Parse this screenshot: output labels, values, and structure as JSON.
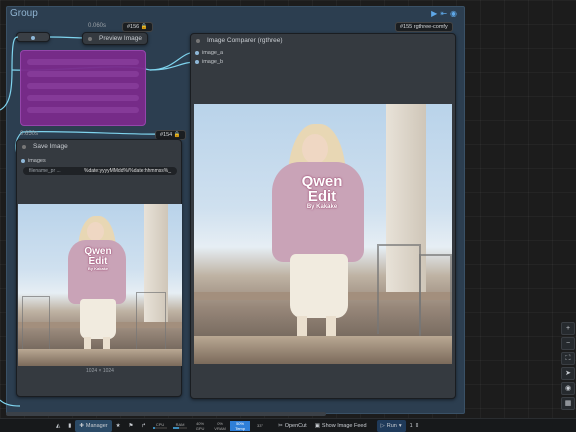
{
  "group": {
    "title": "Group",
    "icons": [
      "play-icon",
      "arrow-icon",
      "eye-icon"
    ]
  },
  "preview_node": {
    "time": "0.060s",
    "id_badge": "#156 🔒",
    "title": "Preview Image"
  },
  "comparer_node": {
    "id_badge": "#155 rgthree-comfy",
    "title": "Image Comparer (rgthree)",
    "inputs": [
      "image_a",
      "image_b"
    ]
  },
  "save_node": {
    "time": "0.650s",
    "id_badge": "#154 🔒",
    "title": "Save Image",
    "inputs": [
      "images"
    ],
    "widget": {
      "label": "filename_pr ...",
      "value": "%date:yyyyMMdd%/%date:hhmmss%_"
    },
    "image_size": "1024 × 1024"
  },
  "shirt_text": {
    "line1": "Qwen",
    "line2": "Edit",
    "line3": "By Kakake"
  },
  "colors": {
    "accent": "#5fa8e8",
    "purple_node": "#7a2a8c",
    "group_bg": "#2c3e50",
    "wire": "#7fd4ee"
  },
  "toolbar": {
    "manager_label": "Manager",
    "stats": [
      {
        "label": "CPU",
        "value": "",
        "fill": 0.15,
        "color": "#3c8dbc"
      },
      {
        "label": "RAM",
        "value": "",
        "fill": 0.4,
        "color": "#3c8dbc"
      },
      {
        "label": "40%",
        "value": "GPU",
        "fill": 0.4,
        "color": "#3c8dbc"
      },
      {
        "label": "0%",
        "value": "VRAM",
        "fill": 0.0,
        "color": "#3c8dbc"
      },
      {
        "label": "50%",
        "value": "Temp",
        "fill": 0.5,
        "color": "#2f7fd8"
      },
      {
        "label": "33°",
        "value": "",
        "fill": 0.33,
        "color": "#3c8dbc"
      }
    ],
    "opencut_label": "OpenCut",
    "feed_label": "Show Image Feed",
    "run_label": "Run",
    "queue_count": "1"
  },
  "side_buttons": [
    "plus-icon",
    "minus-icon",
    "fit-icon",
    "navigate-icon",
    "eye-icon",
    "map-icon"
  ]
}
